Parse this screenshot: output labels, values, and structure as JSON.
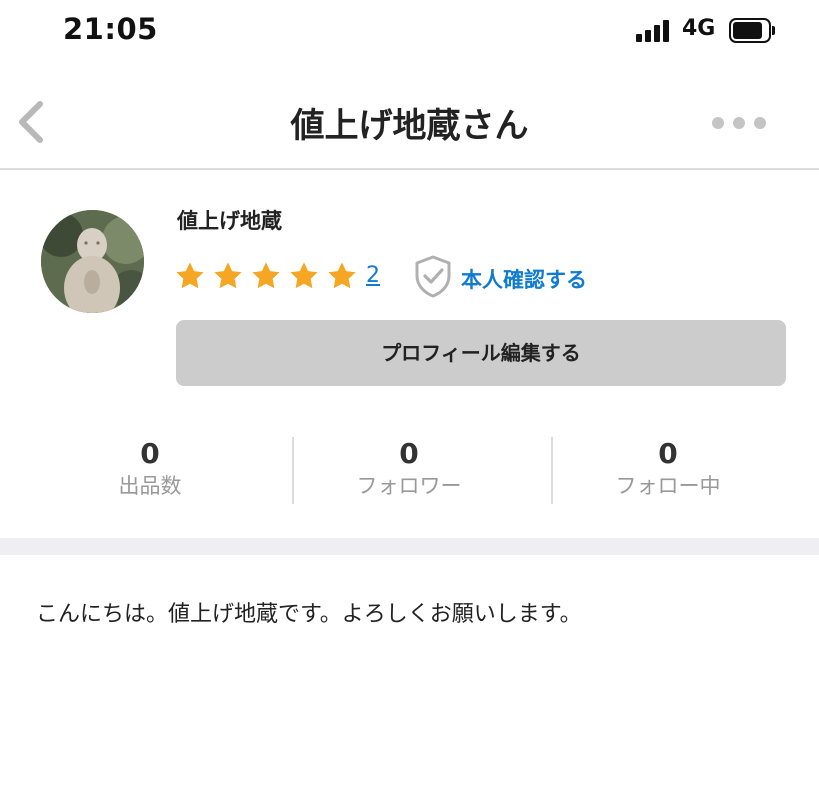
{
  "status_bar": {
    "time": "21:05",
    "network": "4G",
    "icons": [
      "signal-icon",
      "battery-icon"
    ]
  },
  "nav": {
    "title": "値上げ地蔵さん",
    "back_icon": "chevron-left-icon",
    "more_icon": "more-dots-icon"
  },
  "profile": {
    "name": "値上げ地蔵",
    "rating_stars": 5,
    "rating_max": 5,
    "rating_count": "2",
    "verify_label": "本人確認する",
    "edit_button_label": "プロフィール編集する"
  },
  "stats": [
    {
      "value": "0",
      "label": "出品数"
    },
    {
      "value": "0",
      "label": "フォロワー"
    },
    {
      "value": "0",
      "label": "フォロー中"
    }
  ],
  "bio": "こんにちは。値上げ地蔵です。よろしくお願いします。",
  "colors": {
    "star": "#F5A623",
    "link": "#0F7CCF",
    "button_bg": "#CCCCCC",
    "divider": "#DDDDDD",
    "section_gap": "#EFEEF2"
  }
}
